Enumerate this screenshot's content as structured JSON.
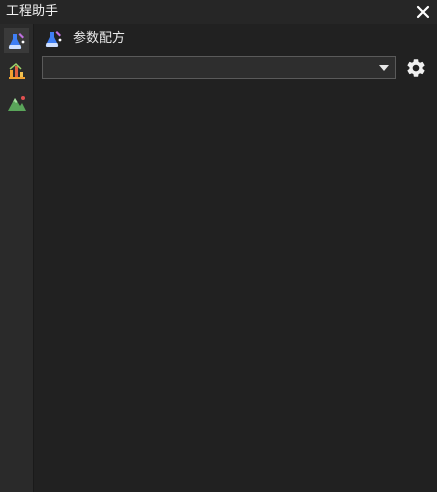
{
  "window": {
    "title": "工程助手",
    "close_icon": "close-icon"
  },
  "sidebar": {
    "items": [
      {
        "name": "recipe",
        "icon": "flask-icon",
        "active": true
      },
      {
        "name": "analysis",
        "icon": "bar-chart-icon",
        "active": false
      },
      {
        "name": "terrain",
        "icon": "mountain-icon",
        "active": false
      }
    ]
  },
  "panel": {
    "title": "参数配方",
    "icon": "flask-icon"
  },
  "recipe_selector": {
    "selected_value": "",
    "arrow_icon": "caret-down-icon"
  },
  "settings": {
    "icon": "gear-icon"
  },
  "colors": {
    "background": "#212121",
    "sidebar": "#2a2a2a",
    "text": "#f2f2f2",
    "accent_blue": "#3f7ff5",
    "accent_orange": "#f0a030",
    "accent_green": "#5aa55a"
  }
}
